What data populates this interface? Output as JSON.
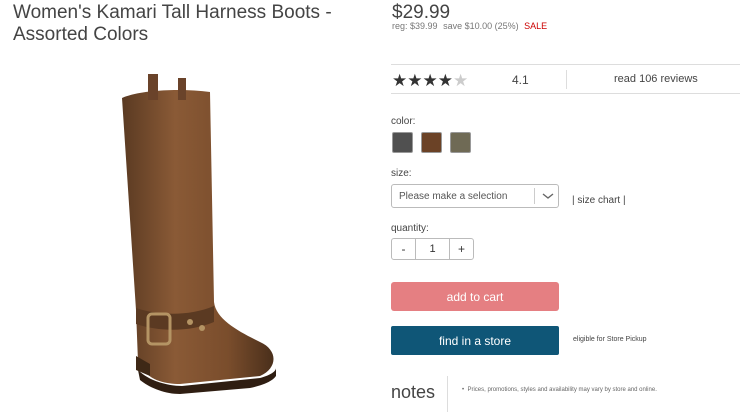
{
  "product": {
    "title": "Women's Kamari Tall Harness Boots - Assorted Colors",
    "image_alt_icon": "boot-image"
  },
  "pricing": {
    "price": "$29.99",
    "reg": "reg: $39.99",
    "save": "save $10.00 (25%)",
    "sale_label": "SALE",
    "sale_color": "#cc0000"
  },
  "rating": {
    "stars_filled": 4,
    "stars_total": 5,
    "value": "4.1",
    "reviews_link": "read 106 reviews"
  },
  "color": {
    "label": "color:",
    "swatches": [
      {
        "name": "dark-gray",
        "hex": "#505050"
      },
      {
        "name": "brown",
        "hex": "#6b4226"
      },
      {
        "name": "olive",
        "hex": "#6f6a55"
      }
    ]
  },
  "size": {
    "label": "size:",
    "placeholder": "Please make a selection",
    "chart_link": "size chart"
  },
  "quantity": {
    "label": "quantity:",
    "minus": "-",
    "value": "1",
    "plus": "+"
  },
  "actions": {
    "add_to_cart": "add to cart",
    "add_to_cart_color": "#e57f82",
    "find_in_store": "find in a store",
    "find_in_store_color": "#0f5677",
    "eligible": "eligible for Store Pickup"
  },
  "notes": {
    "title": "notes",
    "bullet": "Prices, promotions, styles and availability may vary by store and online."
  }
}
